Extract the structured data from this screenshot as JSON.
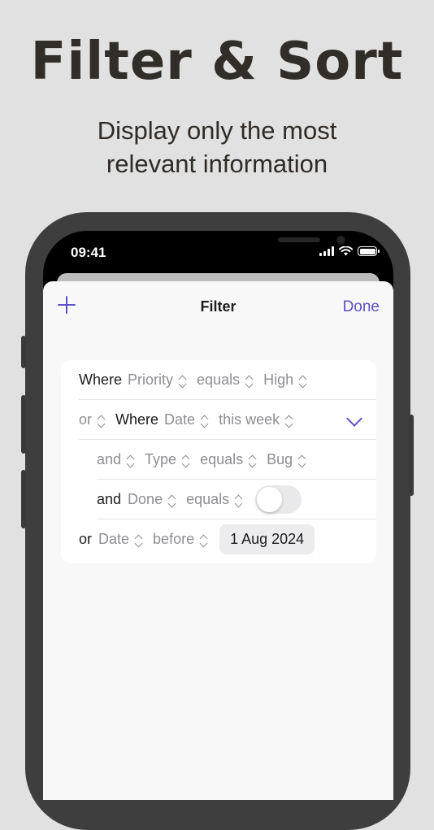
{
  "headline": "Filter & Sort",
  "subheadline": [
    "Display only the most",
    "relevant information"
  ],
  "status_bar": {
    "time": "09:41"
  },
  "nav": {
    "title": "Filter",
    "done_label": "Done",
    "add_icon": "plus-icon"
  },
  "filters": [
    {
      "conj": "Where",
      "field": "Priority",
      "op": "equals",
      "value": "High"
    },
    {
      "prefix": "or",
      "conj": "Where",
      "field": "Date",
      "op": "this week",
      "expanded": true
    },
    {
      "conj": "and",
      "field": "Type",
      "op": "equals",
      "value": "Bug"
    },
    {
      "conj": "and",
      "field": "Done",
      "op": "equals",
      "toggle_on": false
    },
    {
      "conj": "or",
      "field": "Date",
      "op": "before",
      "value": "1 Aug 2024"
    }
  ],
  "colors": {
    "accent": "#5a50c8",
    "background": "#e1e1e1",
    "phone_frame": "#3e3e3e"
  }
}
